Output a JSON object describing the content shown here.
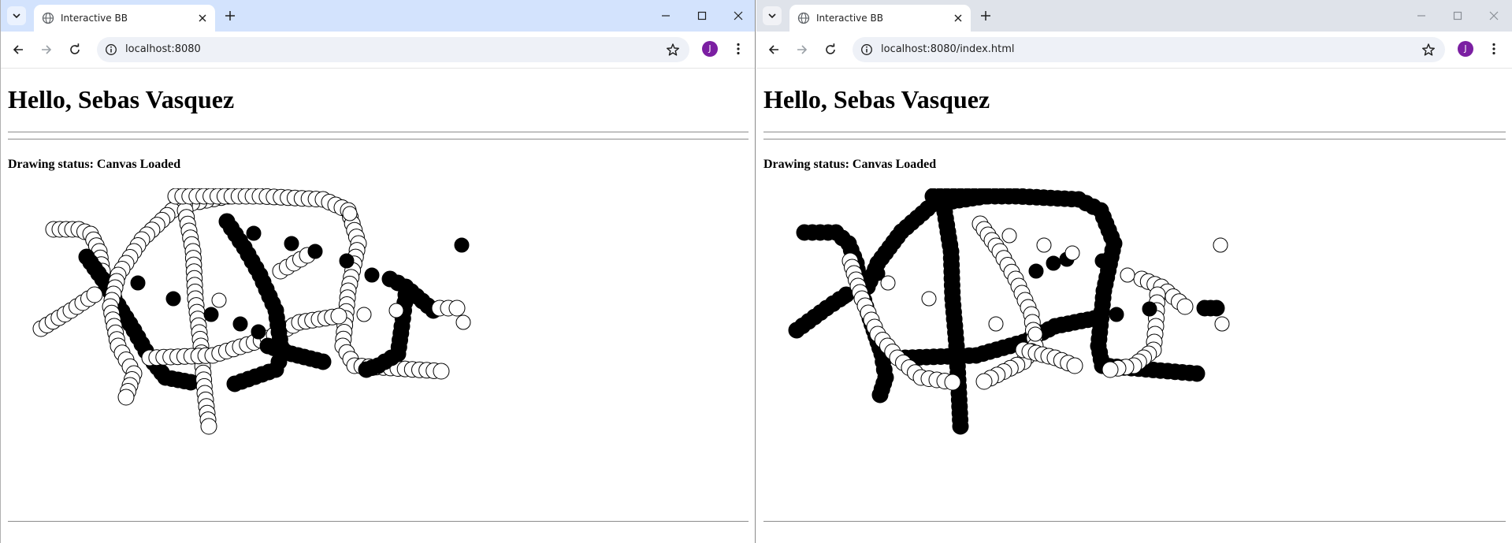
{
  "windows": [
    {
      "id": "left",
      "tab_title": "Interactive BB",
      "url": "localhost:8080",
      "avatar_initial": "J",
      "heading": "Hello, Sebas Vasquez",
      "status_label": "Drawing status:",
      "status_value": "Canvas Loaded"
    },
    {
      "id": "right",
      "tab_title": "Interactive BB",
      "url": "localhost:8080/index.html",
      "avatar_initial": "J",
      "heading": "Hello, Sebas Vasquez",
      "status_label": "Drawing status:",
      "status_value": "Canvas Loaded"
    }
  ],
  "icons": {
    "tab_menu": "chevron-down-icon",
    "favicon": "globe-icon",
    "tab_close": "close-icon",
    "new_tab": "plus-icon",
    "minimize": "minimize-icon",
    "maximize": "maximize-icon",
    "close_window": "close-icon",
    "back": "arrow-left-icon",
    "forward": "arrow-right-icon",
    "reload": "reload-icon",
    "site_info": "info-icon",
    "bookmark": "star-icon",
    "menu": "kebab-icon"
  },
  "colors": {
    "titlebar_active": "#d3e3fd",
    "titlebar_inactive": "#dfe3ea",
    "omnibox": "#eef1f7",
    "avatar": "#7b1fa2",
    "stroke_white_fill": "#ffffff",
    "stroke_black_fill": "#000000"
  }
}
